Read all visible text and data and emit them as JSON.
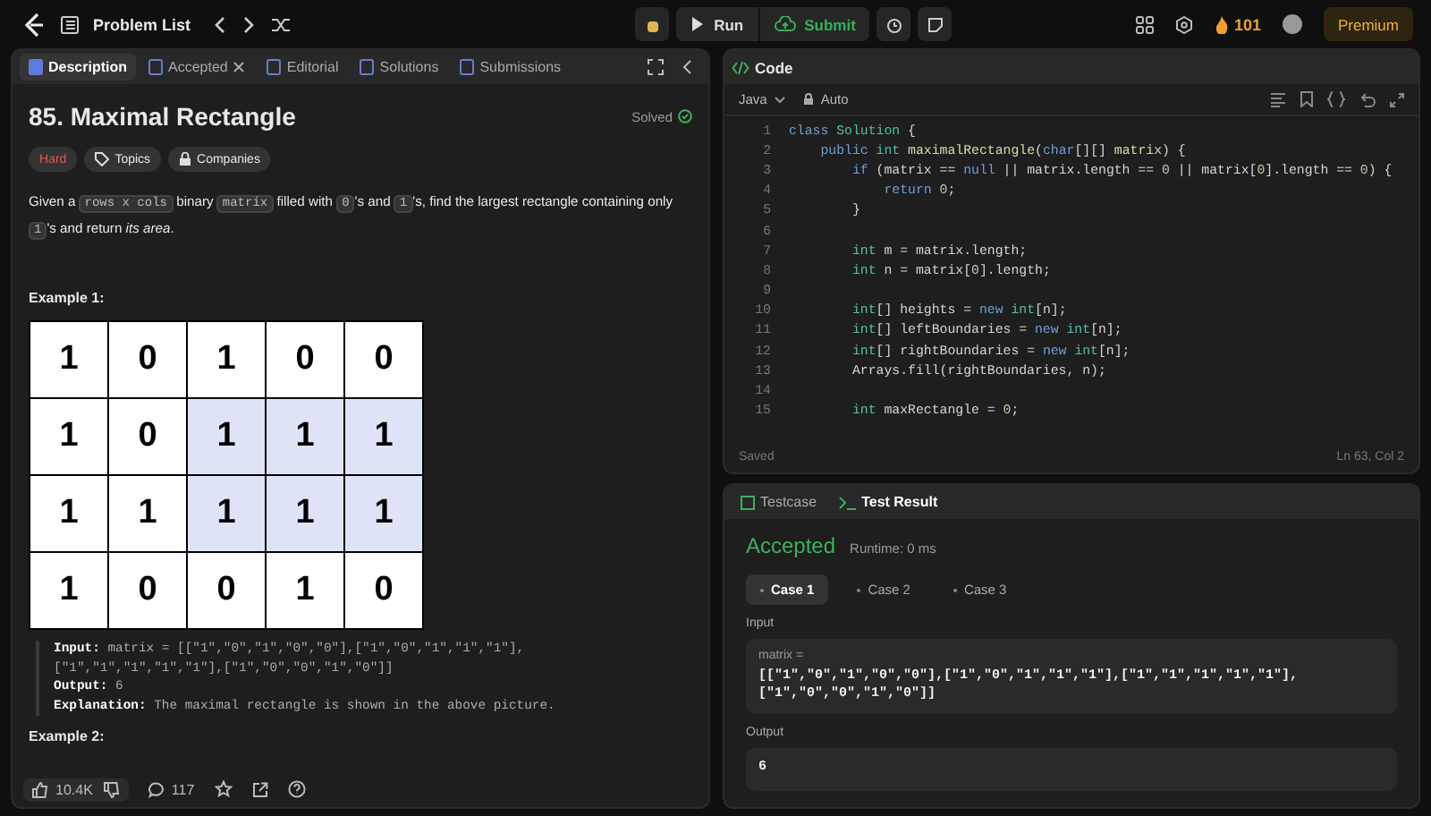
{
  "topbar": {
    "title": "Problem List",
    "run": "Run",
    "submit": "Submit",
    "streak": "101",
    "premium": "Premium"
  },
  "left_tabs": [
    {
      "label": "Description",
      "selected": true,
      "closable": false
    },
    {
      "label": "Accepted",
      "selected": false,
      "closable": true
    },
    {
      "label": "Editorial",
      "selected": false,
      "closable": false
    },
    {
      "label": "Solutions",
      "selected": false,
      "closable": false
    },
    {
      "label": "Submissions",
      "selected": false,
      "closable": false
    }
  ],
  "problem": {
    "title": "85. Maximal Rectangle",
    "status": "Solved",
    "difficulty": "Hard",
    "tags": [
      "Topics",
      "Companies"
    ],
    "description": [
      {
        "kind": "text",
        "t": "Given a "
      },
      {
        "kind": "code",
        "t": "rows x cols"
      },
      {
        "kind": "text",
        "t": " binary "
      },
      {
        "kind": "code",
        "t": "matrix"
      },
      {
        "kind": "text",
        "t": " filled with "
      },
      {
        "kind": "code",
        "t": "0"
      },
      {
        "kind": "text",
        "t": "'s and "
      },
      {
        "kind": "code",
        "t": "1"
      },
      {
        "kind": "text",
        "t": "'s, find the largest rectangle containing only "
      },
      {
        "kind": "code",
        "t": "1"
      },
      {
        "kind": "text",
        "t": "'s and return *its area*."
      }
    ],
    "example_title": "Example 1:",
    "grid": [
      [
        {
          "v": "1",
          "highlighted": false
        },
        {
          "v": "0",
          "highlighted": false
        },
        {
          "v": "1",
          "highlighted": false
        },
        {
          "v": "0",
          "highlighted": false
        },
        {
          "v": "0",
          "highlighted": false
        }
      ],
      [
        {
          "v": "1",
          "highlighted": false
        },
        {
          "v": "0",
          "highlighted": false
        },
        {
          "v": "1",
          "highlighted": true
        },
        {
          "v": "1",
          "highlighted": true
        },
        {
          "v": "1",
          "highlighted": true
        }
      ],
      [
        {
          "v": "1",
          "highlighted": false
        },
        {
          "v": "1",
          "highlighted": false
        },
        {
          "v": "1",
          "highlighted": true
        },
        {
          "v": "1",
          "highlighted": true
        },
        {
          "v": "1",
          "highlighted": true
        }
      ],
      [
        {
          "v": "1",
          "highlighted": false
        },
        {
          "v": "0",
          "highlighted": false
        },
        {
          "v": "0",
          "highlighted": false
        },
        {
          "v": "1",
          "highlighted": false
        },
        {
          "v": "0",
          "highlighted": false
        }
      ]
    ],
    "example_lines": [
      {
        "label": "Input:",
        "text": "matrix = [[\"1\",\"0\",\"1\",\"0\",\"0\"],[\"1\",\"0\",\"1\",\"1\",\"1\"],[\"1\",\"1\",\"1\",\"1\",\"1\"],[\"1\",\"0\",\"0\",\"1\",\"0\"]]"
      },
      {
        "label": "Output:",
        "text": "6"
      },
      {
        "label": "Explanation:",
        "text": "The maximal rectangle is shown in the above picture."
      }
    ],
    "example2_title": "Example 2:"
  },
  "footer": {
    "likes": "10.4K",
    "comments": "117"
  },
  "code": {
    "title": "Code",
    "language": "Java",
    "mode": "Auto",
    "saved": "Saved",
    "cursor": "Ln 63, Col 2",
    "lines": [
      {
        "number": "1",
        "tokens": [
          {
            "kind": "kw",
            "t": "class "
          },
          {
            "kind": "ty",
            "t": "Solution "
          },
          {
            "kind": "p",
            "t": "{"
          }
        ]
      },
      {
        "number": "2",
        "tokens": [
          {
            "kind": "kw",
            "t": "    public "
          },
          {
            "kind": "ty",
            "t": "int "
          },
          {
            "kind": "fn",
            "t": "maximalRectangle"
          },
          {
            "kind": "p",
            "t": "("
          },
          {
            "kind": "kw",
            "t": "char"
          },
          {
            "kind": "p",
            "t": "[][] "
          },
          {
            "kind": "fn",
            "t": "matrix"
          },
          {
            "kind": "p",
            "t": ") {"
          }
        ]
      },
      {
        "number": "3",
        "tokens": [
          {
            "kind": "kw",
            "t": "        if "
          },
          {
            "kind": "p",
            "t": "(matrix == "
          },
          {
            "kind": "kw",
            "t": "null "
          },
          {
            "kind": "p",
            "t": "|| matrix.length == "
          },
          {
            "kind": "n",
            "t": "0 "
          },
          {
            "kind": "p",
            "t": "|| matrix["
          },
          {
            "kind": "n",
            "t": "0"
          },
          {
            "kind": "p",
            "t": "].length == "
          },
          {
            "kind": "n",
            "t": "0"
          },
          {
            "kind": "p",
            "t": ") {"
          }
        ]
      },
      {
        "number": "4",
        "tokens": [
          {
            "kind": "kw",
            "t": "            return "
          },
          {
            "kind": "n",
            "t": "0"
          },
          {
            "kind": "p",
            "t": ";"
          }
        ]
      },
      {
        "number": "5",
        "tokens": [
          {
            "kind": "p",
            "t": "        }"
          }
        ]
      },
      {
        "number": "6"
      },
      {
        "number": "7",
        "tokens": [
          {
            "kind": "ty",
            "t": "        int "
          },
          {
            "kind": "p",
            "t": "m = matrix.length;"
          }
        ]
      },
      {
        "number": "8",
        "tokens": [
          {
            "kind": "ty",
            "t": "        int "
          },
          {
            "kind": "p",
            "t": "n = matrix["
          },
          {
            "kind": "n",
            "t": "0"
          },
          {
            "kind": "p",
            "t": "].length;"
          }
        ]
      },
      {
        "number": "9"
      },
      {
        "number": "10",
        "tokens": [
          {
            "kind": "ty",
            "t": "        int"
          },
          {
            "kind": "p",
            "t": "[] heights = "
          },
          {
            "kind": "kw",
            "t": "new "
          },
          {
            "kind": "ty",
            "t": "int"
          },
          {
            "kind": "p",
            "t": "[n];"
          }
        ]
      },
      {
        "number": "11",
        "tokens": [
          {
            "kind": "ty",
            "t": "        int"
          },
          {
            "kind": "p",
            "t": "[] leftBoundaries = "
          },
          {
            "kind": "kw",
            "t": "new "
          },
          {
            "kind": "ty",
            "t": "int"
          },
          {
            "kind": "p",
            "t": "[n];"
          }
        ]
      },
      {
        "number": "12",
        "tokens": [
          {
            "kind": "ty",
            "t": "        int"
          },
          {
            "kind": "p",
            "t": "[] rightBoundaries = "
          },
          {
            "kind": "kw",
            "t": "new "
          },
          {
            "kind": "ty",
            "t": "int"
          },
          {
            "kind": "p",
            "t": "[n];"
          }
        ]
      },
      {
        "number": "13",
        "tokens": [
          {
            "kind": "p",
            "t": "        Arrays.fill(rightBoundaries, n);"
          }
        ]
      },
      {
        "number": "14"
      },
      {
        "number": "15",
        "tokens": [
          {
            "kind": "ty",
            "t": "        int "
          },
          {
            "kind": "p",
            "t": "maxRectangle = "
          },
          {
            "kind": "n",
            "t": "0"
          },
          {
            "kind": "p",
            "t": ";"
          }
        ]
      }
    ]
  },
  "test_tabs": [
    {
      "label": "Testcase",
      "selected": false
    },
    {
      "label": "Test Result",
      "selected": true
    }
  ],
  "result": {
    "verdict": "Accepted",
    "runtime": "Runtime: 0 ms",
    "cases": [
      {
        "label": "Case 1",
        "selected": true
      },
      {
        "label": "Case 2",
        "selected": false
      },
      {
        "label": "Case 3",
        "selected": false
      }
    ],
    "input_label": "Input",
    "var_label": "matrix =",
    "input_value": "[[\"1\",\"0\",\"1\",\"0\",\"0\"],[\"1\",\"0\",\"1\",\"1\",\"1\"],[\"1\",\"1\",\"1\",\"1\",\"1\"],[\"1\",\"0\",\"0\",\"1\",\"0\"]]",
    "output_label": "Output",
    "output_value": "6"
  }
}
